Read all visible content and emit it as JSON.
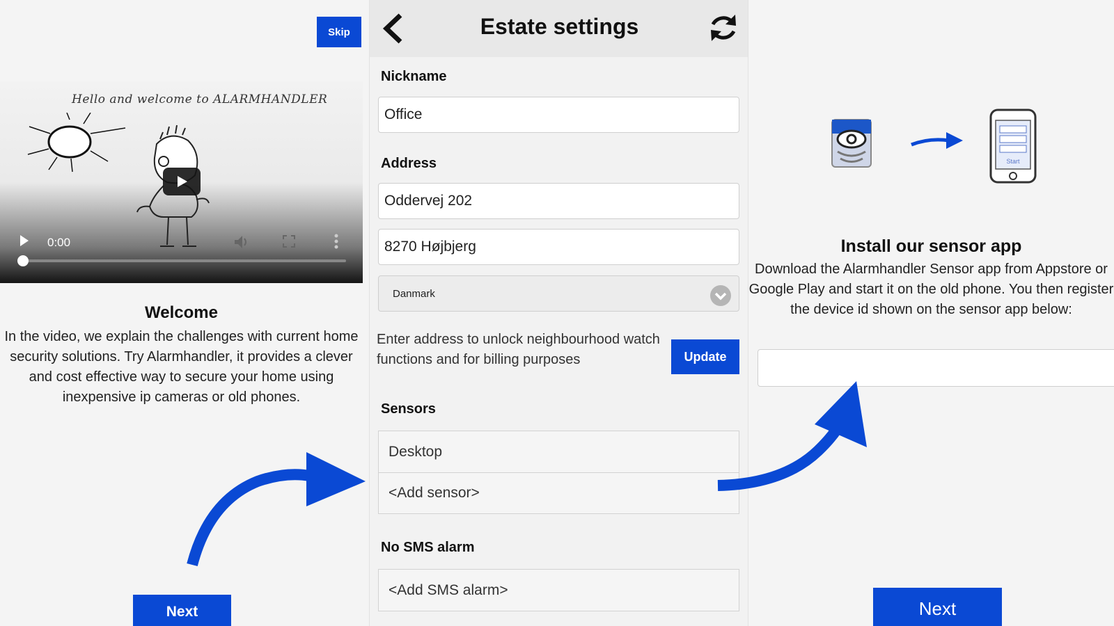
{
  "welcome_screen": {
    "skip_label": "Skip",
    "video": {
      "caption": "Hello and welcome to ALARMHANDLER",
      "time": "0:00"
    },
    "title": "Welcome",
    "text": "In the video, we explain the challenges with current home security solutions. Try Alarmhandler, it provides a clever and cost effective way to secure your home using inexpensive ip cameras or old phones.",
    "next_label": "Next"
  },
  "estate_settings": {
    "title": "Estate settings",
    "nickname_label": "Nickname",
    "nickname_value": "Office",
    "address_label": "Address",
    "address_line1": "Oddervej 202",
    "address_line2": "8270 Højbjerg",
    "country": "Danmark",
    "address_note": "Enter address to unlock neighbourhood watch functions and for billing purposes",
    "update_label": "Update",
    "sensors_label": "Sensors",
    "sensors": [
      "Desktop",
      "<Add sensor>"
    ],
    "sms_label": "No SMS alarm",
    "sms_items": [
      "<Add SMS alarm>"
    ]
  },
  "sensor_app_screen": {
    "title": "Install our sensor app",
    "text": "Download the Alarmhandler Sensor app from Appstore or Google Play and start it on the old phone. You then register the device id shown on the sensor app below:",
    "device_id_value": "",
    "phone_screen_label": "Start",
    "next_label": "Next"
  },
  "colors": {
    "accent": "#0a49d4",
    "panel_bg": "#f4f4f4",
    "header_bg": "#e8e8e8"
  },
  "icons": [
    "play-icon",
    "volume-icon",
    "fullscreen-icon",
    "more-icon",
    "back-icon",
    "refresh-icon",
    "chevron-down-icon",
    "sensor-camera-icon",
    "arrow-right-icon",
    "phone-icon"
  ]
}
